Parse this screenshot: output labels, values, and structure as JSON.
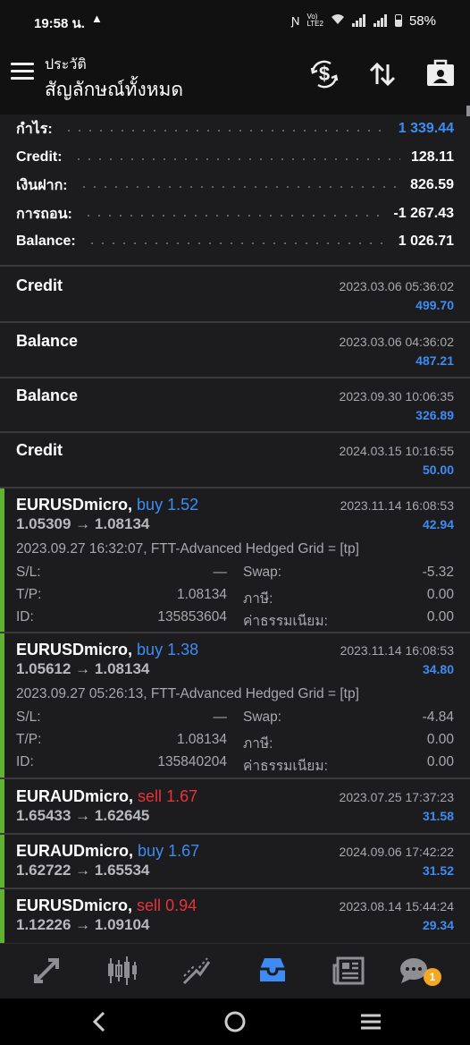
{
  "status_bar": {
    "time": "19:58 น.",
    "alert": "▲",
    "battery": "58%"
  },
  "header": {
    "title": "ประวัติ",
    "subtitle": "สัญลักษณ์ทั้งหมด",
    "icons": [
      "currency-exchange-icon",
      "sort-icon",
      "portfolio-icon"
    ]
  },
  "summary": {
    "profit_label": "กำไร:",
    "profit_value": "1 339.44",
    "credit_label": "Credit:",
    "credit_value": "128.11",
    "deposit_label": "เงินฝาก:",
    "deposit_value": "826.59",
    "withdrawal_label": "การถอน:",
    "withdrawal_value": "-1 267.43",
    "balance_label": "Balance:",
    "balance_value": "1 026.71"
  },
  "balance_ops": [
    {
      "title": "Credit",
      "date": "2023.03.06 05:36:02",
      "amount": "499.70"
    },
    {
      "title": "Balance",
      "date": "2023.03.06 04:36:02",
      "amount": "487.21"
    },
    {
      "title": "Balance",
      "date": "2023.09.30 10:06:35",
      "amount": "326.89"
    },
    {
      "title": "Credit",
      "date": "2024.03.15 10:16:55",
      "amount": "50.00"
    }
  ],
  "deals": [
    {
      "symbol": "EURUSDmicro,",
      "side": "buy",
      "volume": "1.52",
      "prices": "1.05309 → 1.08134",
      "date": "2023.11.14 16:08:53",
      "profit": "42.94",
      "comment": "2023.09.27 16:32:07, FTT-Advanced Hedged Grid = [tp]",
      "sl_label": "S/L:",
      "sl": "—",
      "tp_label": "T/P:",
      "tp": "1.08134",
      "id_label": "ID:",
      "id": "135853604",
      "swap_label": "Swap:",
      "swap": "-5.32",
      "tax_label": "ภาษี:",
      "tax": "0.00",
      "fee_label": "ค่าธรรมเนียม:",
      "fee": "0.00"
    },
    {
      "symbol": "EURUSDmicro,",
      "side": "buy",
      "volume": "1.38",
      "prices": "1.05612 → 1.08134",
      "date": "2023.11.14 16:08:53",
      "profit": "34.80",
      "comment": "2023.09.27 05:26:13, FTT-Advanced Hedged Grid = [tp]",
      "sl_label": "S/L:",
      "sl": "—",
      "tp_label": "T/P:",
      "tp": "1.08134",
      "id_label": "ID:",
      "id": "135840204",
      "swap_label": "Swap:",
      "swap": "-4.84",
      "tax_label": "ภาษี:",
      "tax": "0.00",
      "fee_label": "ค่าธรรมเนียม:",
      "fee": "0.00"
    },
    {
      "symbol": "EURAUDmicro,",
      "side": "sell",
      "volume": "1.67",
      "prices": "1.65433 → 1.62645",
      "date": "2023.07.25 17:37:23",
      "profit": "31.58"
    },
    {
      "symbol": "EURAUDmicro,",
      "side": "buy",
      "volume": "1.67",
      "prices": "1.62722 → 1.65534",
      "date": "2024.09.06 17:42:22",
      "profit": "31.52"
    },
    {
      "symbol": "EURUSDmicro,",
      "side": "sell",
      "volume": "0.94",
      "prices": "1.12226 → 1.09104",
      "date": "2023.08.14 15:44:24",
      "profit": "29.34"
    }
  ],
  "bottom_nav": {
    "items": [
      "quotes-icon",
      "chart-icon",
      "trade-icon",
      "history-icon",
      "news-icon",
      "chat-icon"
    ],
    "active": "history-icon",
    "chat_badge": "1"
  },
  "colors": {
    "accent_blue": "#3d8cf4",
    "sell_red": "#e8333c",
    "deal_bar_green": "#61b22f",
    "badge_orange": "#f5a623"
  }
}
